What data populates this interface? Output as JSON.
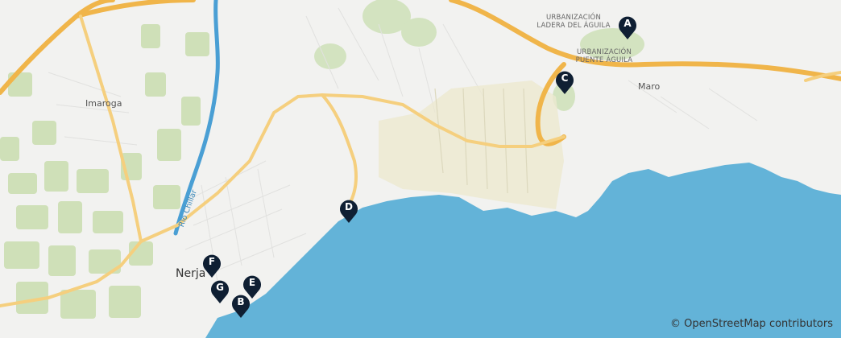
{
  "map": {
    "places": {
      "nerja": "Nerja",
      "imaroga": "Imaroga",
      "maro": "Maro",
      "ladera_line1": "URBANIZACIÓN",
      "ladera_line2": "LADERA DEL ÁGUILA",
      "puente_line1": "URBANIZACIÓN",
      "puente_line2": "PUENTE ÁGUILA"
    },
    "river_label": "Río Chíllar",
    "markers": [
      {
        "id": "A",
        "label": "A"
      },
      {
        "id": "B",
        "label": "B"
      },
      {
        "id": "C",
        "label": "C"
      },
      {
        "id": "D",
        "label": "D"
      },
      {
        "id": "E",
        "label": "E"
      },
      {
        "id": "F",
        "label": "F"
      },
      {
        "id": "G",
        "label": "G"
      }
    ],
    "attribution": "© OpenStreetMap contributors",
    "colors": {
      "sea": "#63b3d8",
      "land": "#f2f2f0",
      "highway": "#f0b54a",
      "river": "#4a9fd4",
      "marker": "#0f1f33",
      "green": "#c8dcb0",
      "beach": "#ece8c8"
    }
  }
}
